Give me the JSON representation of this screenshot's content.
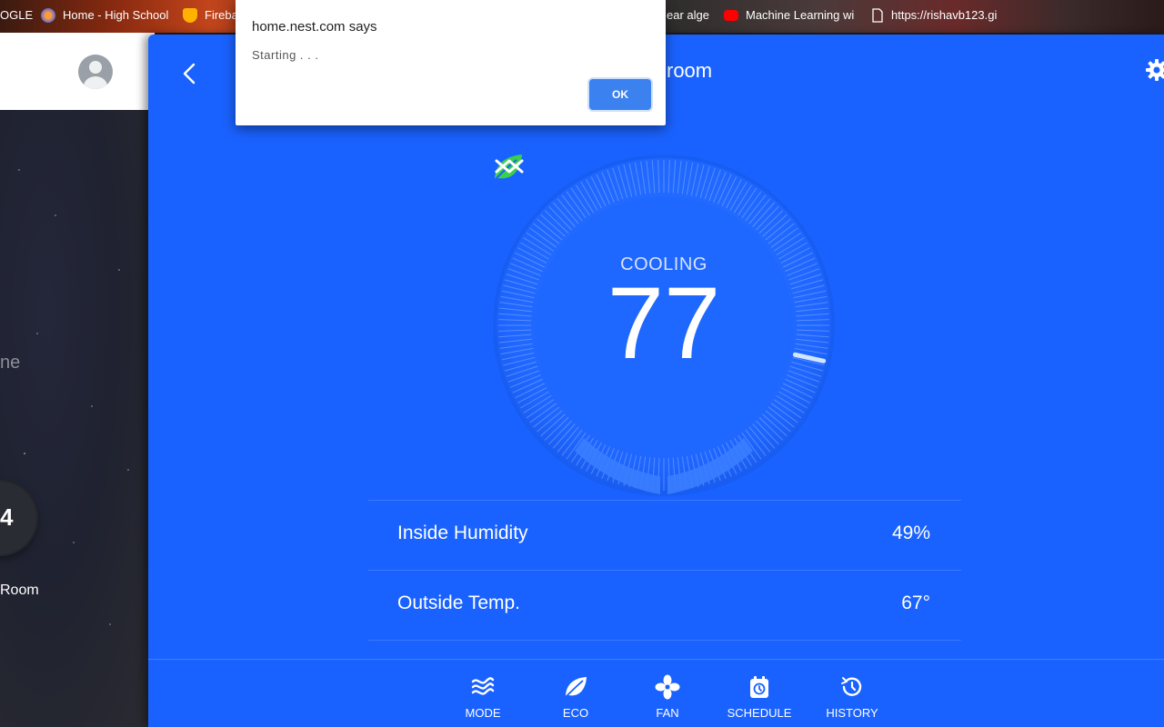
{
  "bookmarks": [
    {
      "label": "OGLE",
      "icon": "bookmark-icon"
    },
    {
      "label": "Home - High School",
      "icon": "school-icon"
    },
    {
      "label": "Fireba",
      "icon": "firebase-icon"
    },
    {
      "label": "ear alge",
      "icon": "bookmark-icon"
    },
    {
      "label": "Machine Learning wi",
      "icon": "youtube-icon"
    },
    {
      "label": "https://rishavb123.gi",
      "icon": "page-icon"
    }
  ],
  "left_page": {
    "partial_text": "ne",
    "mini_thermostat_value": "4",
    "room_label": "Room"
  },
  "panel": {
    "room_title": "room",
    "mode": "COOLING",
    "target_temp": "77",
    "setpoint_level": 0.88
  },
  "stats": [
    {
      "label": "Inside Humidity",
      "value": "49%"
    },
    {
      "label": "Outside Temp.",
      "value": "67°"
    }
  ],
  "nav": [
    {
      "label": "MODE",
      "icon": "mode-icon"
    },
    {
      "label": "ECO",
      "icon": "leaf-icon"
    },
    {
      "label": "FAN",
      "icon": "fan-icon"
    },
    {
      "label": "SCHEDULE",
      "icon": "schedule-icon"
    },
    {
      "label": "HISTORY",
      "icon": "history-icon"
    }
  ],
  "dialog": {
    "title": "home.nest.com says",
    "message": "Starting . . .",
    "ok_label": "OK"
  },
  "colors": {
    "panel_blue": "#1a62ff",
    "dial_blue": "#2a72ff",
    "leaf_green": "#3ccf4e",
    "ok_button": "#3b82f0"
  }
}
